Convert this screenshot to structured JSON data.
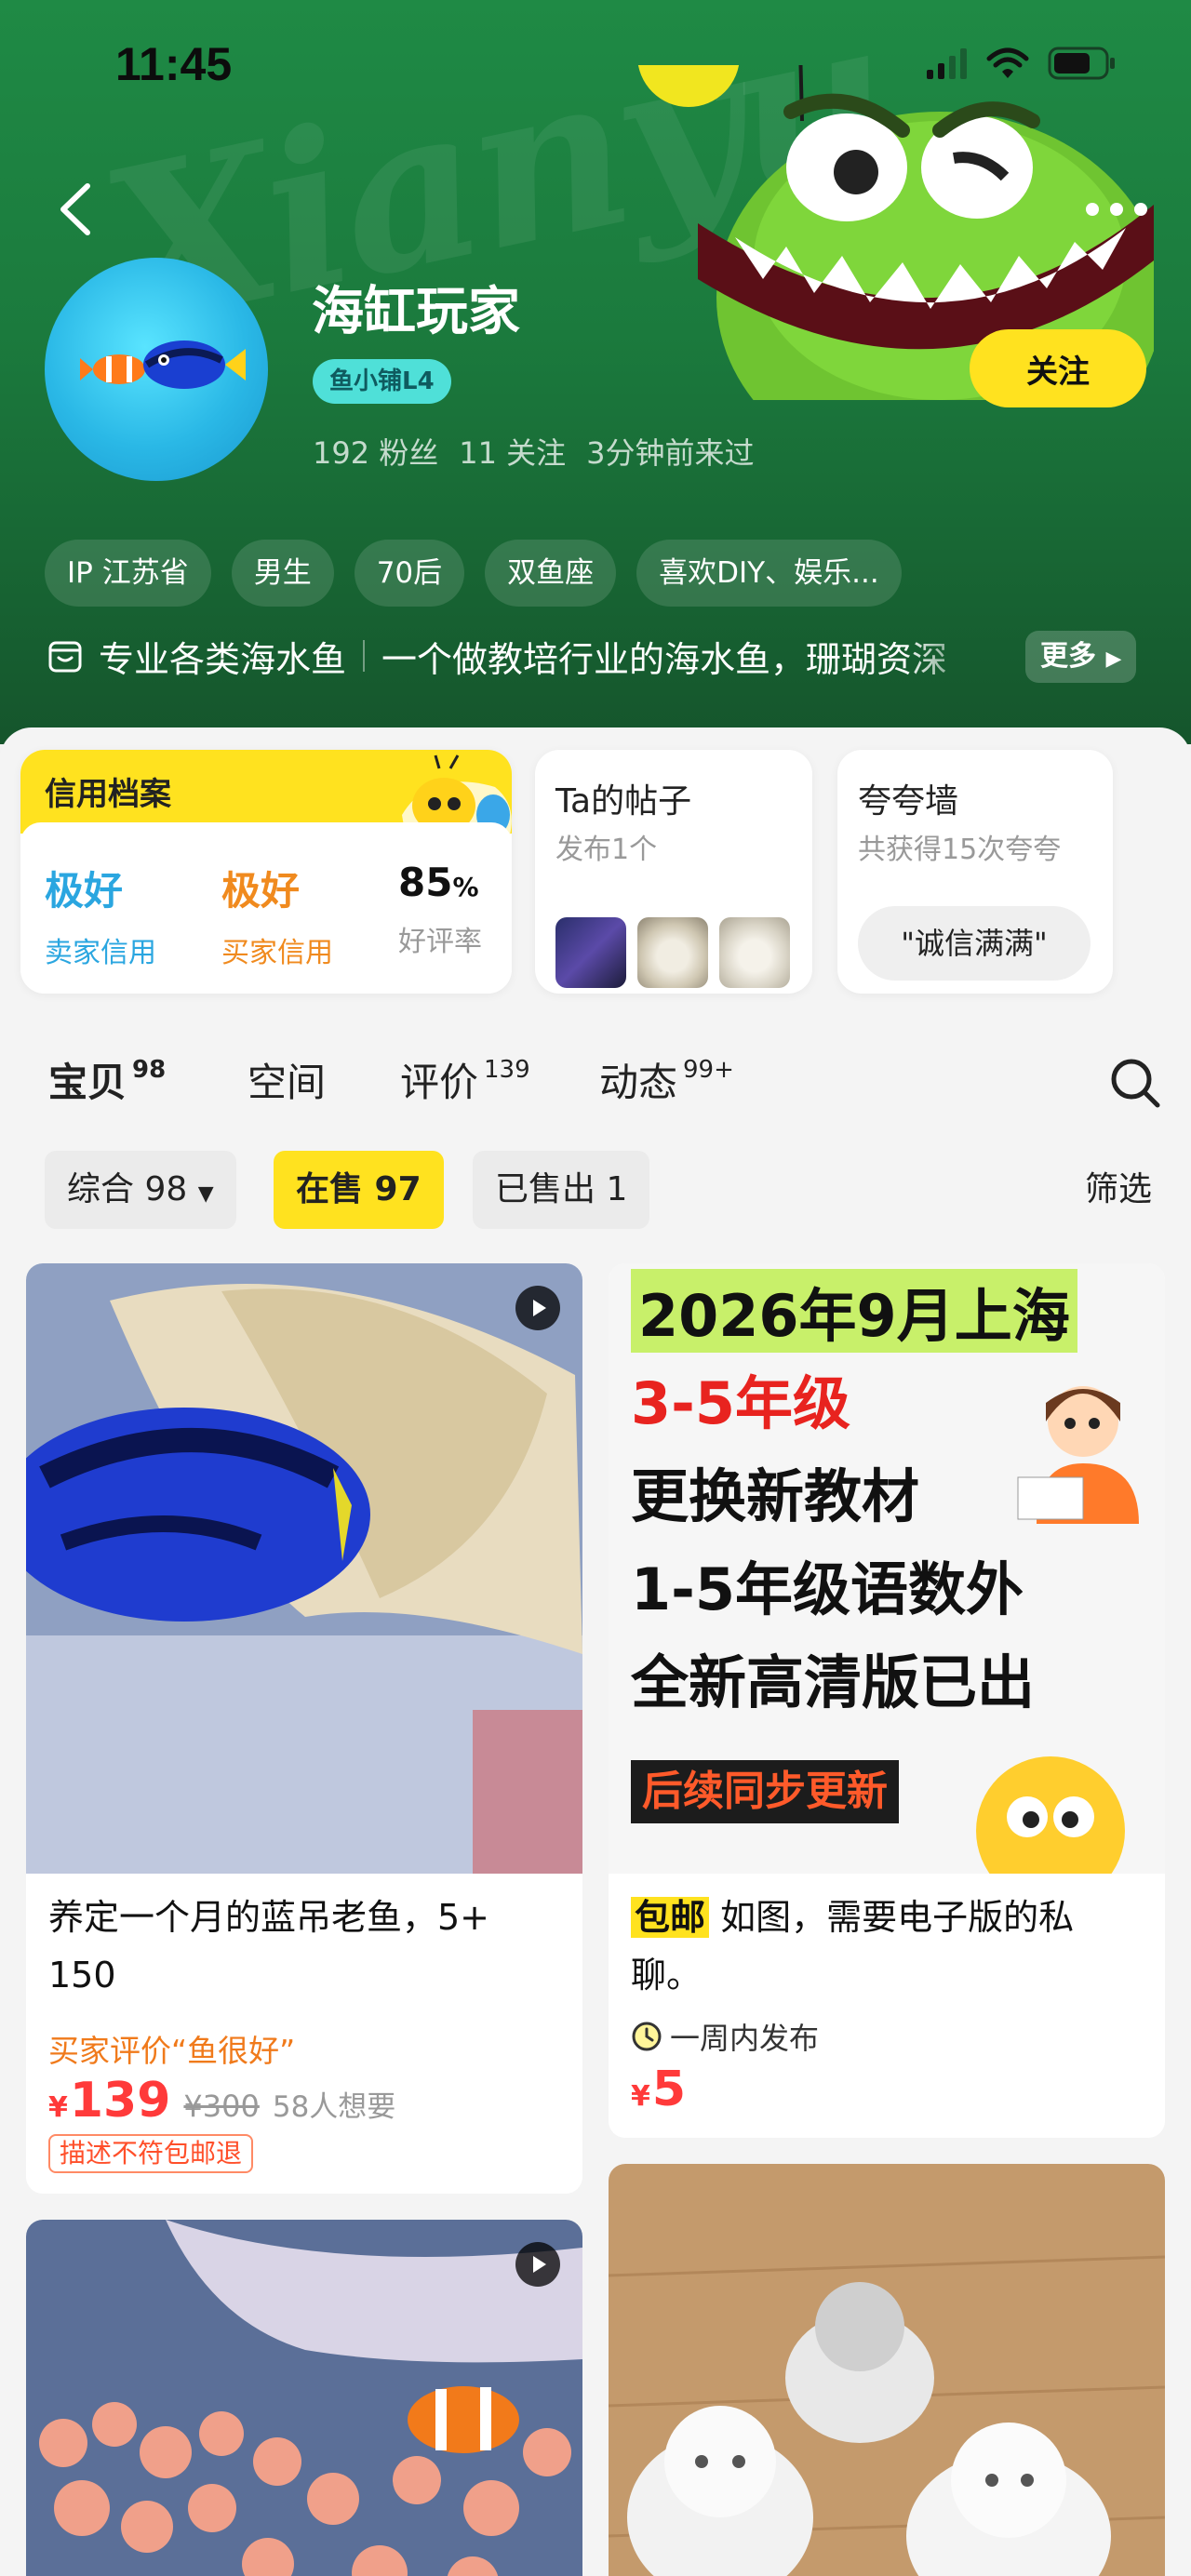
{
  "status_bar": {
    "time": "11:45"
  },
  "profile": {
    "username": "海缸玩家",
    "level_badge": "鱼小铺L4",
    "fans": "192 粉丝",
    "following": "11 关注",
    "last_seen": "3分钟前来过",
    "follow_label": "关注",
    "tags": [
      "IP 江苏省",
      "男生",
      "70后",
      "双鱼座",
      "喜欢DIY、娱乐..."
    ],
    "shop_name": "专业各类海水鱼",
    "bio": "一个做教培行业的海水鱼，珊瑚资深",
    "more_label": "更多"
  },
  "credit": {
    "title": "信用档案",
    "seller_value": "极好",
    "seller_label": "卖家信用",
    "buyer_value": "极好",
    "buyer_label": "买家信用",
    "rating_value": "85",
    "rating_unit": "%",
    "rating_label": "好评率"
  },
  "posts": {
    "title": "Ta的帖子",
    "subtitle": "发布1个"
  },
  "praise": {
    "title": "夸夸墙",
    "subtitle": "共获得15次夸夸",
    "tag": "\"诚信满满\""
  },
  "tabs": [
    {
      "label": "宝贝",
      "count": "98"
    },
    {
      "label": "空间",
      "count": ""
    },
    {
      "label": "评价",
      "count": "139"
    },
    {
      "label": "动态",
      "count": "99+"
    }
  ],
  "filters": {
    "all": "综合 98",
    "on_sale": "在售 97",
    "sold": "已售出 1",
    "filter": "筛选"
  },
  "products": [
    {
      "title": "养定一个月的蓝吊老鱼，5+ 150",
      "review": "买家评价“鱼很好”",
      "currency": "¥",
      "price": "139",
      "old_price": "¥300",
      "wants": "58人想要",
      "guarantee": "描述不符包邮退"
    },
    {
      "image_lines": [
        "2026年9月上海",
        "3-5年级",
        "更换新教材",
        "1-5年级语数外",
        "全新高清版已出",
        "后续同步更新"
      ],
      "free_ship": "包邮",
      "title": "如图，需要电子版的私聊。",
      "time": "一周内发布",
      "currency": "¥",
      "price": "5"
    }
  ],
  "colors": {
    "accent": "#ffe21f",
    "price": "#ff3a3a",
    "header_green": "#1b7a3d",
    "seller_blue": "#2aa6e0",
    "buyer_orange": "#f08a1e"
  }
}
